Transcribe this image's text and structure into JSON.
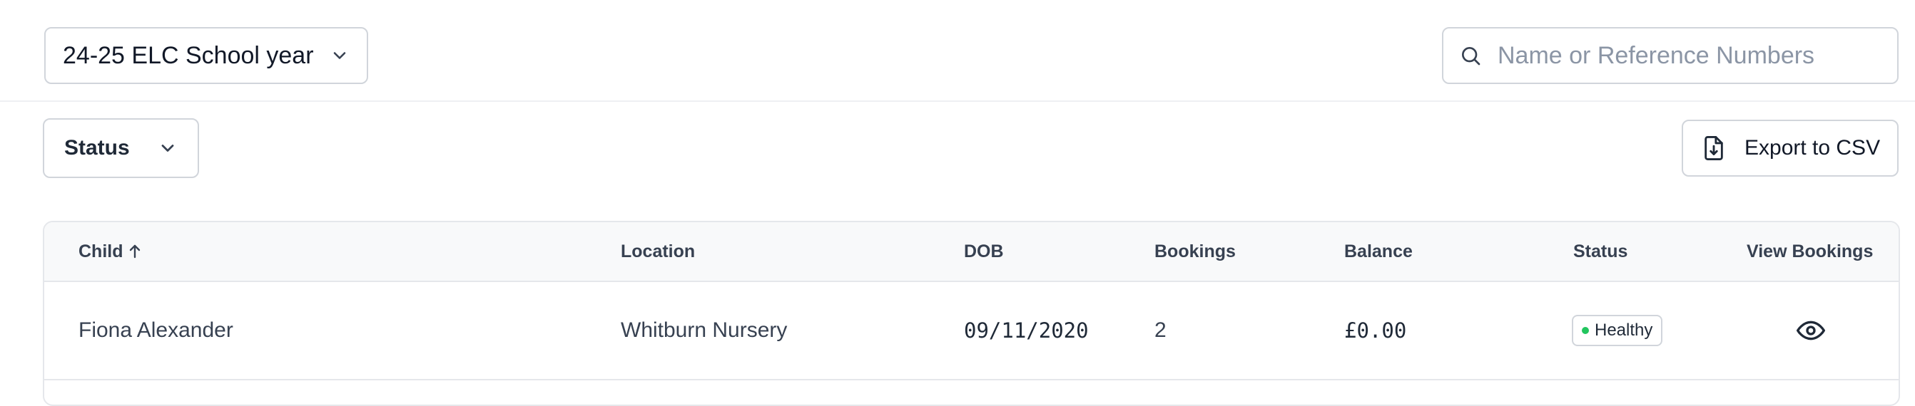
{
  "filters": {
    "year_select_value": "24-25 ELC School year",
    "search_placeholder": "Name or Reference Numbers",
    "status_filter_label": "Status",
    "export_label": "Export to CSV"
  },
  "table": {
    "columns": {
      "child": "Child",
      "location": "Location",
      "dob": "DOB",
      "bookings": "Bookings",
      "balance": "Balance",
      "status": "Status",
      "view_bookings": "View Bookings"
    },
    "sort_icon": "arrow-up-icon",
    "rows": [
      {
        "child": "Fiona Alexander",
        "location": "Whitburn Nursery",
        "dob": "09/11/2020",
        "bookings": "2",
        "balance": "£0.00",
        "status": "Healthy",
        "status_color": "#22c55e"
      }
    ]
  },
  "icons": {
    "year_select": "chevron-down-icon",
    "search": "search-icon",
    "status_filter": "chevron-down-icon",
    "export": "file-download-icon",
    "view_bookings": "eye-icon"
  }
}
